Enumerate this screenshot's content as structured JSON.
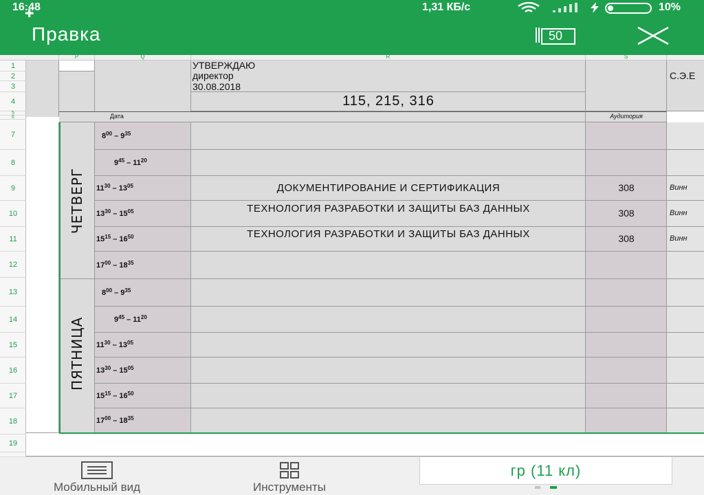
{
  "status_bar": {
    "time": "16:48",
    "speed": "1,31 КБ/с",
    "battery": "10%",
    "icons": [
      "cursor-cross-icon",
      "wifi-icon",
      "signal-icon",
      "charging-icon",
      "battery-icon"
    ]
  },
  "toolbar": {
    "title": "Правка",
    "sheets_count": "50",
    "accent": "#1fa04f"
  },
  "columns": [
    "P",
    "Q",
    "R",
    "S"
  ],
  "rows": [
    "1",
    "2",
    "3",
    "4",
    "5",
    "6",
    "7",
    "8",
    "9",
    "10",
    "11",
    "12",
    "13",
    "14",
    "15",
    "16",
    "17",
    "18",
    "19"
  ],
  "header": {
    "approve": "УТВЕРЖДАЮ",
    "director": "директор",
    "date": "30.08.2018",
    "signature": "С.Э.Е",
    "groups": "115, 215, 316",
    "col_date": "Дата",
    "col_room": "Аудитория"
  },
  "days": [
    {
      "name": "ЧЕТВЕРГ",
      "slots": [
        {
          "start": "8",
          "start_min": "00",
          "end": "9",
          "end_min": "35",
          "subject": "",
          "room": "",
          "teacher": ""
        },
        {
          "start": "9",
          "start_min": "45",
          "end": "11",
          "end_min": "20",
          "subject": "",
          "room": "",
          "teacher": ""
        },
        {
          "start": "11",
          "start_min": "30",
          "end": "13",
          "end_min": "05",
          "subject": "ДОКУМЕНТИРОВАНИЕ И СЕРТИФИКАЦИЯ",
          "room": "308",
          "teacher": "Винн"
        },
        {
          "start": "13",
          "start_min": "30",
          "end": "15",
          "end_min": "05",
          "subject": "ТЕХНОЛОГИЯ РАЗРАБОТКИ И ЗАЩИТЫ БАЗ ДАННЫХ",
          "room": "308",
          "teacher": "Винн"
        },
        {
          "start": "15",
          "start_min": "15",
          "end": "16",
          "end_min": "50",
          "subject": "ТЕХНОЛОГИЯ РАЗРАБОТКИ И ЗАЩИТЫ БАЗ ДАННЫХ",
          "room": "308",
          "teacher": "Винн"
        },
        {
          "start": "17",
          "start_min": "00",
          "end": "18",
          "end_min": "35",
          "subject": "",
          "room": "",
          "teacher": ""
        }
      ]
    },
    {
      "name": "ПЯТНИЦА",
      "slots": [
        {
          "start": "8",
          "start_min": "00",
          "end": "9",
          "end_min": "35",
          "subject": "",
          "room": "",
          "teacher": ""
        },
        {
          "start": "9",
          "start_min": "45",
          "end": "11",
          "end_min": "20",
          "subject": "",
          "room": "",
          "teacher": ""
        },
        {
          "start": "11",
          "start_min": "30",
          "end": "13",
          "end_min": "05",
          "subject": "",
          "room": "",
          "teacher": ""
        },
        {
          "start": "13",
          "start_min": "30",
          "end": "15",
          "end_min": "05",
          "subject": "",
          "room": "",
          "teacher": ""
        },
        {
          "start": "15",
          "start_min": "15",
          "end": "16",
          "end_min": "50",
          "subject": "",
          "room": "",
          "teacher": ""
        },
        {
          "start": "17",
          "start_min": "00",
          "end": "18",
          "end_min": "35",
          "subject": "",
          "room": "",
          "teacher": ""
        }
      ]
    }
  ],
  "bottom_nav": {
    "mobile_view": "Мобильный вид",
    "tools": "Инструменты",
    "sheet_tab": "гр (11 кл)"
  }
}
